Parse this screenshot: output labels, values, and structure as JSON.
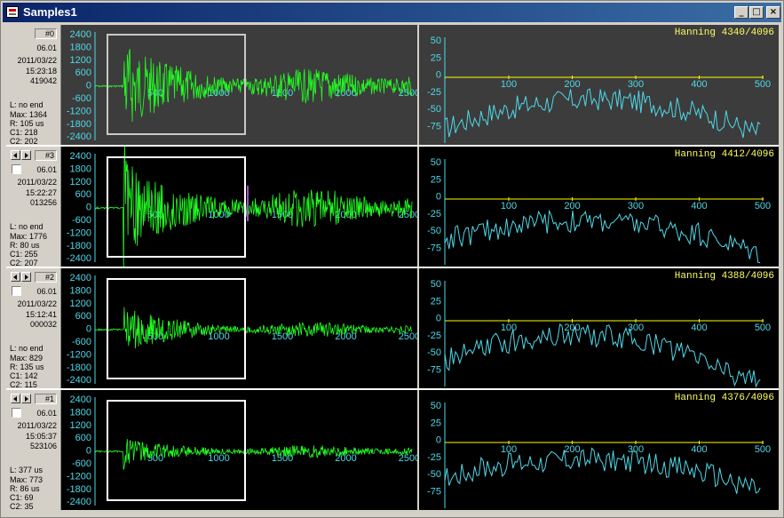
{
  "window": {
    "title": "Samples1",
    "min": "_",
    "max": "□",
    "close": "×"
  },
  "colors": {
    "wave": "#22ff22",
    "spectrum": "#4fd8e8",
    "zero_line": "#ffff00",
    "label": "#4fd8e8"
  },
  "wave_axis": {
    "yticks": [
      "2400",
      "1800",
      "1200",
      "600",
      "0",
      "-600",
      "-1200",
      "-1800",
      "-2400"
    ],
    "xticks": [
      "500",
      "1000",
      "1500",
      "2000",
      "2500"
    ]
  },
  "spec_axis": {
    "yticks": [
      "50",
      "25",
      "0",
      "-25",
      "-50",
      "-75"
    ],
    "xticks": [
      "100",
      "200",
      "300",
      "400",
      "500"
    ]
  },
  "channels": [
    {
      "id": "#0",
      "freq": "06.01",
      "date": "2011/03/22",
      "time": "15:23:18",
      "count": "419042",
      "l": "L: no end",
      "max": "Max: 1364",
      "r": "R: 105 us",
      "c1": "C1: 218",
      "c2": "C2: 202",
      "spectrum_label": "Hanning 4340/4096",
      "has_nav": false,
      "selected": true
    },
    {
      "id": "#3",
      "freq": "06.01",
      "date": "2011/03/22",
      "time": "15:22:27",
      "count": "013256",
      "l": "L: no end",
      "max": "Max: 1776",
      "r": "R: 80 us",
      "c1": "C1: 255",
      "c2": "C2: 207",
      "spectrum_label": "Hanning 4412/4096",
      "has_nav": true,
      "selected": false
    },
    {
      "id": "#2",
      "freq": "06.01",
      "date": "2011/03/22",
      "time": "15:12:41",
      "count": "000032",
      "l": "L: no end",
      "max": "Max: 829",
      "r": "R: 135 us",
      "c1": "C1: 142",
      "c2": "C2: 115",
      "spectrum_label": "Hanning 4388/4096",
      "has_nav": true,
      "selected": false
    },
    {
      "id": "#1",
      "freq": "06.01",
      "date": "2011/03/22",
      "time": "15:05:37",
      "count": "523106",
      "l": "L: 377 us",
      "max": "Max: 773",
      "r": "R: 86 us",
      "c1": "C1: 69",
      "c2": "C2: 35",
      "spectrum_label": "Hanning 4376/4096",
      "has_nav": true,
      "selected": false
    }
  ]
}
